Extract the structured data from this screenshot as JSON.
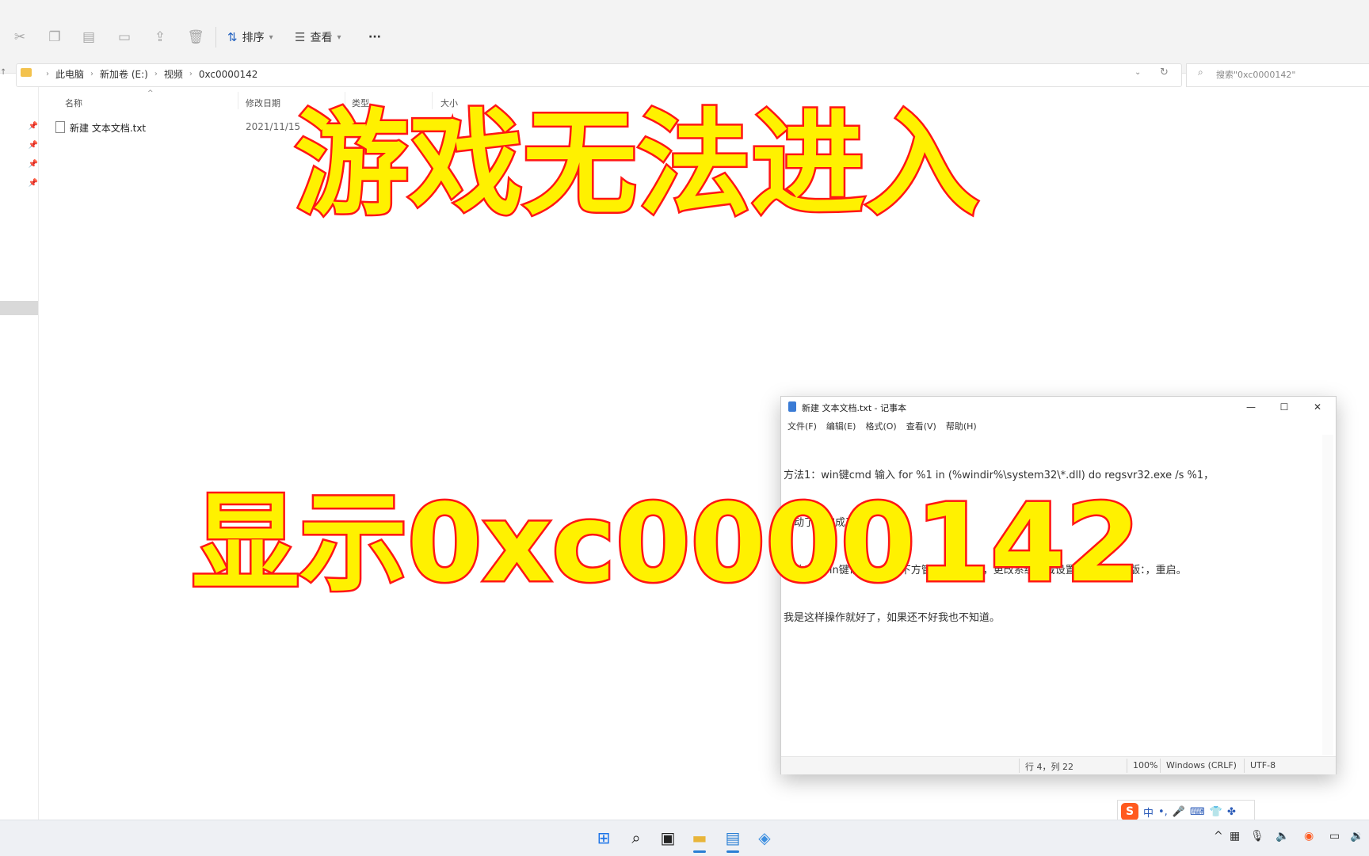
{
  "explorer": {
    "toolbar": {
      "sort_label": "排序",
      "view_label": "查看",
      "more_label": "···"
    },
    "breadcrumbs": [
      "此电脑",
      "新加卷 (E:)",
      "视频",
      "0xc0000142"
    ],
    "search_placeholder": "搜索\"0xc0000142\"",
    "columns": [
      "名称",
      "修改日期",
      "类型",
      "大小"
    ],
    "file": {
      "name": "新建 文本文档.txt",
      "date": "2021/11/15"
    }
  },
  "overlay": {
    "title_top": "游戏无法进入",
    "title_bottom": "显示0xc0000142"
  },
  "notepad": {
    "title": "新建 文本文档.txt - 记事本",
    "menu": [
      "文件(F)",
      "编辑(E)",
      "格式(O)",
      "查看(V)",
      "帮助(H)"
    ],
    "lines": [
      "方法1：win键cmd 输入 for %1 in (%windir%\\system32\\*.dll) do regsvr32.exe /s %1，",
      "不动了就完成了。",
      "方法2：win键语言，右侧下方管理语言设置，更改系统区域设置，勾选beta版：，重启。",
      "我是这样操作就好了，如果还不好我也不知道。"
    ],
    "status": {
      "position": "行 4，列 22",
      "zoom": "100%",
      "eol": "Windows (CRLF)",
      "encoding": "UTF-8"
    }
  },
  "ime": {
    "logo": "S",
    "mode": "中"
  },
  "colors": {
    "overlay_fill": "#fff100",
    "overlay_stroke": "#ff1a1a",
    "accent": "#1f5fbf"
  }
}
